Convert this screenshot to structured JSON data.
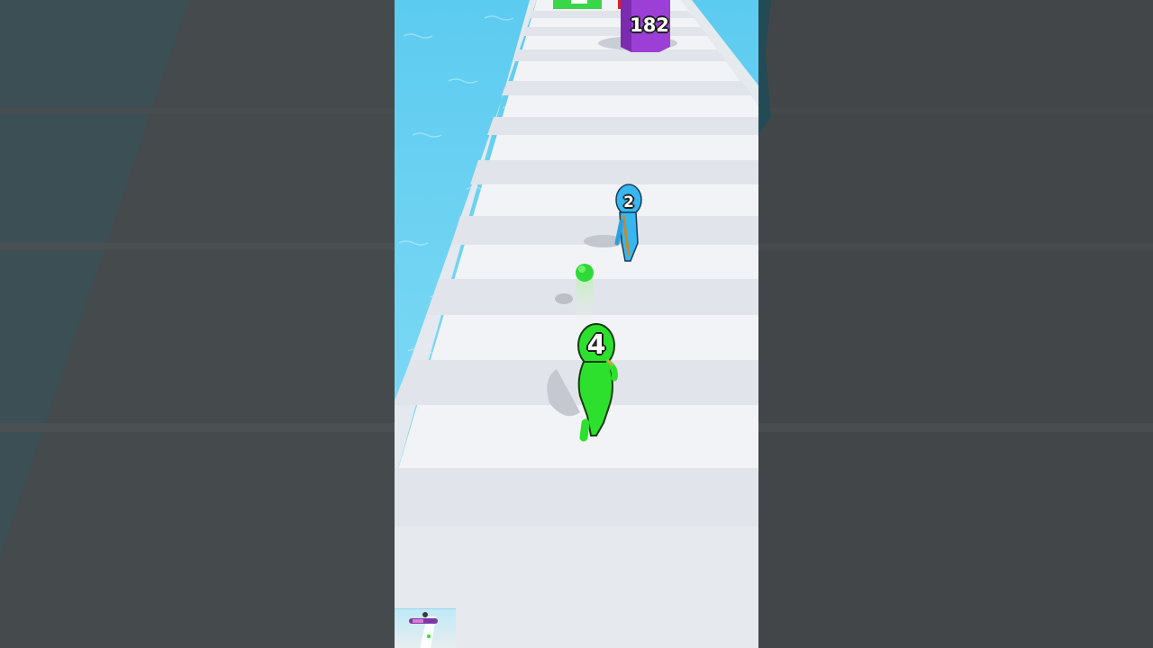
{
  "game": {
    "obstacle_count": "182",
    "player_level": "4",
    "enemy_level": "2"
  },
  "colors": {
    "water": "#5cc9ee",
    "track": "#f0f2f5",
    "player": "#2ee02e",
    "enemy": "#38b6f0",
    "obstacle": "#9b3fd6",
    "background": "#414647"
  },
  "icons": {
    "player": "green-runner",
    "enemy": "blue-runner",
    "obstacle": "purple-pillar",
    "projectile": "green-ball"
  }
}
